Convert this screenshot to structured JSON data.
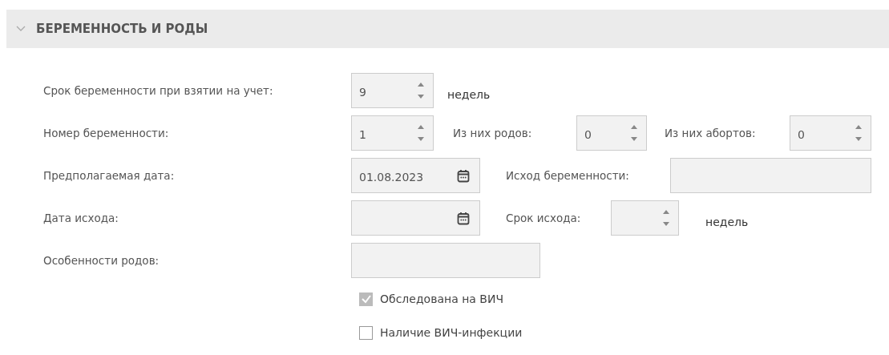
{
  "section": {
    "title": "БЕРЕМЕННОСТЬ И РОДЫ",
    "expanded": true
  },
  "rows": [
    {
      "label": "Срок беременности при взятии на учет:",
      "controls": [
        {
          "kind": "spinner",
          "value": "9"
        },
        {
          "kind": "text",
          "text": "недель"
        }
      ]
    },
    {
      "label": "Номер беременности:",
      "controls": [
        {
          "kind": "spinner",
          "value": "1"
        },
        {
          "kind": "label",
          "text": "Из них родов:"
        },
        {
          "kind": "spinner",
          "value": "0"
        },
        {
          "kind": "label",
          "text": "Из них абортов:"
        },
        {
          "kind": "spinner",
          "value": "0"
        }
      ]
    },
    {
      "label": "Предполагаемая дата:",
      "controls": [
        {
          "kind": "date",
          "value": "01.08.2023"
        },
        {
          "kind": "label",
          "text": "Исход беременности:"
        },
        {
          "kind": "field"
        }
      ]
    },
    {
      "label": "Дата исхода:",
      "controls": [
        {
          "kind": "date"
        },
        {
          "kind": "label",
          "text": "Срок исхода:"
        },
        {
          "kind": "spinner"
        },
        {
          "kind": "text",
          "text": "недель"
        }
      ]
    },
    {
      "label": "Особенности родов:",
      "controls": [
        {
          "kind": "field"
        }
      ]
    }
  ],
  "checkboxes": [
    {
      "label": "Обследована на ВИЧ",
      "checked": true,
      "disabled": true
    },
    {
      "label": "Наличие ВИЧ-инфекции",
      "checked": false,
      "disabled": false
    }
  ]
}
